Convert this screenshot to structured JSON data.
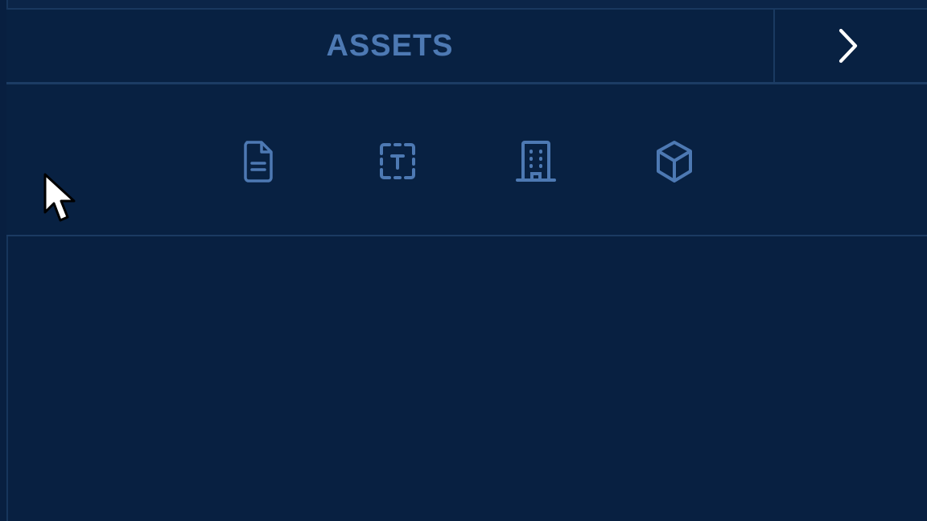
{
  "header": {
    "title": "ASSETS",
    "next_icon": "chevron-right-icon"
  },
  "toolbar": {
    "tools": [
      {
        "icon": "document-icon"
      },
      {
        "icon": "text-selection-icon"
      },
      {
        "icon": "building-icon"
      },
      {
        "icon": "cube-icon"
      }
    ]
  },
  "colors": {
    "background": "#082041",
    "border": "#1c3c64",
    "accent": "#4d79b3",
    "chevron": "#ffffff"
  }
}
